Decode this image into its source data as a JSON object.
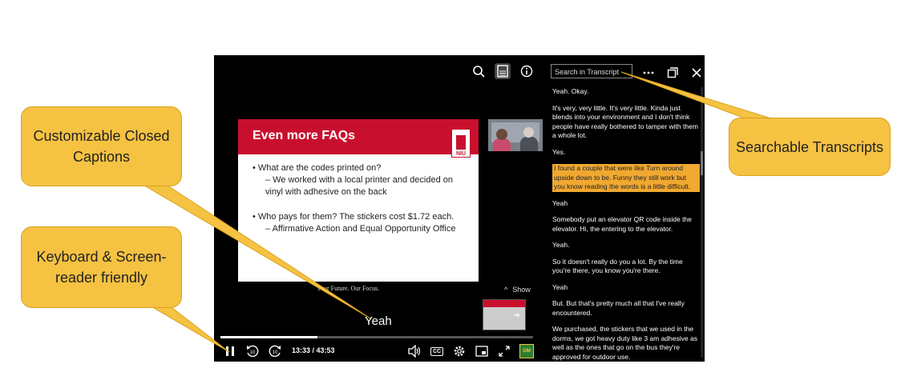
{
  "colors": {
    "accent": "#c8102e",
    "callout": "#f5c242",
    "highlight": "#f0a830"
  },
  "top_icons": [
    "search-icon",
    "transcript-panel-icon",
    "info-icon"
  ],
  "slide": {
    "title": "Even more FAQs",
    "logo_text": "NIU",
    "q1": "• What are the codes printed on?",
    "a1": "– We worked with a local printer and decided on vinyl with adhesive on the back",
    "q2": "• Who pays for them? The stickers cost $1.72 each.",
    "a2": "– Affirmative Action and Equal Opportunity Office",
    "footer": "Your Future. Our Focus."
  },
  "show_label": "Show",
  "show_icon": "^",
  "caption": "Yeah",
  "player": {
    "progress_fraction": 0.31,
    "timecode": "13:33 / 43:53",
    "cc_label": "CC",
    "logo_text": "GM"
  },
  "transcript": {
    "search_placeholder": "Search in Transcript",
    "entries": [
      {
        "text": "Yeah. Okay.",
        "highlight": false
      },
      {
        "text": "It's very, very little. It's very little. Kinda just blends into your environment and I don't think people have really bothered to tamper with them a whole lot.",
        "highlight": false
      },
      {
        "text": "Yes.",
        "highlight": false
      },
      {
        "text": "I found a couple that were like Turn around upside down to be. Funny they still work but you know reading the words is a little difficult.",
        "highlight": true
      },
      {
        "text": "Yeah",
        "highlight": false
      },
      {
        "text": "Somebody put an elevator QR code inside the elevator. Hi, the entering to the elevator.",
        "highlight": false
      },
      {
        "text": "Yeah.",
        "highlight": false
      },
      {
        "text": "So it doesn't really do you a lot. By the time you're there, you know you're there.",
        "highlight": false
      },
      {
        "text": "Yeah",
        "highlight": false
      },
      {
        "text": "But. But that's pretty much all that I've really encountered.",
        "highlight": false
      },
      {
        "text": "We purchased, the stickers that we used in the dorms, we got heavy duty like 3 am adhesive as well as the ones that go on the bus they're approved for outdoor use.",
        "highlight": false
      }
    ]
  },
  "callouts": {
    "captions": "Customizable Closed Captions",
    "keyboard": "Keyboard & Screen-reader friendly",
    "transcripts": "Searchable Transcripts"
  }
}
